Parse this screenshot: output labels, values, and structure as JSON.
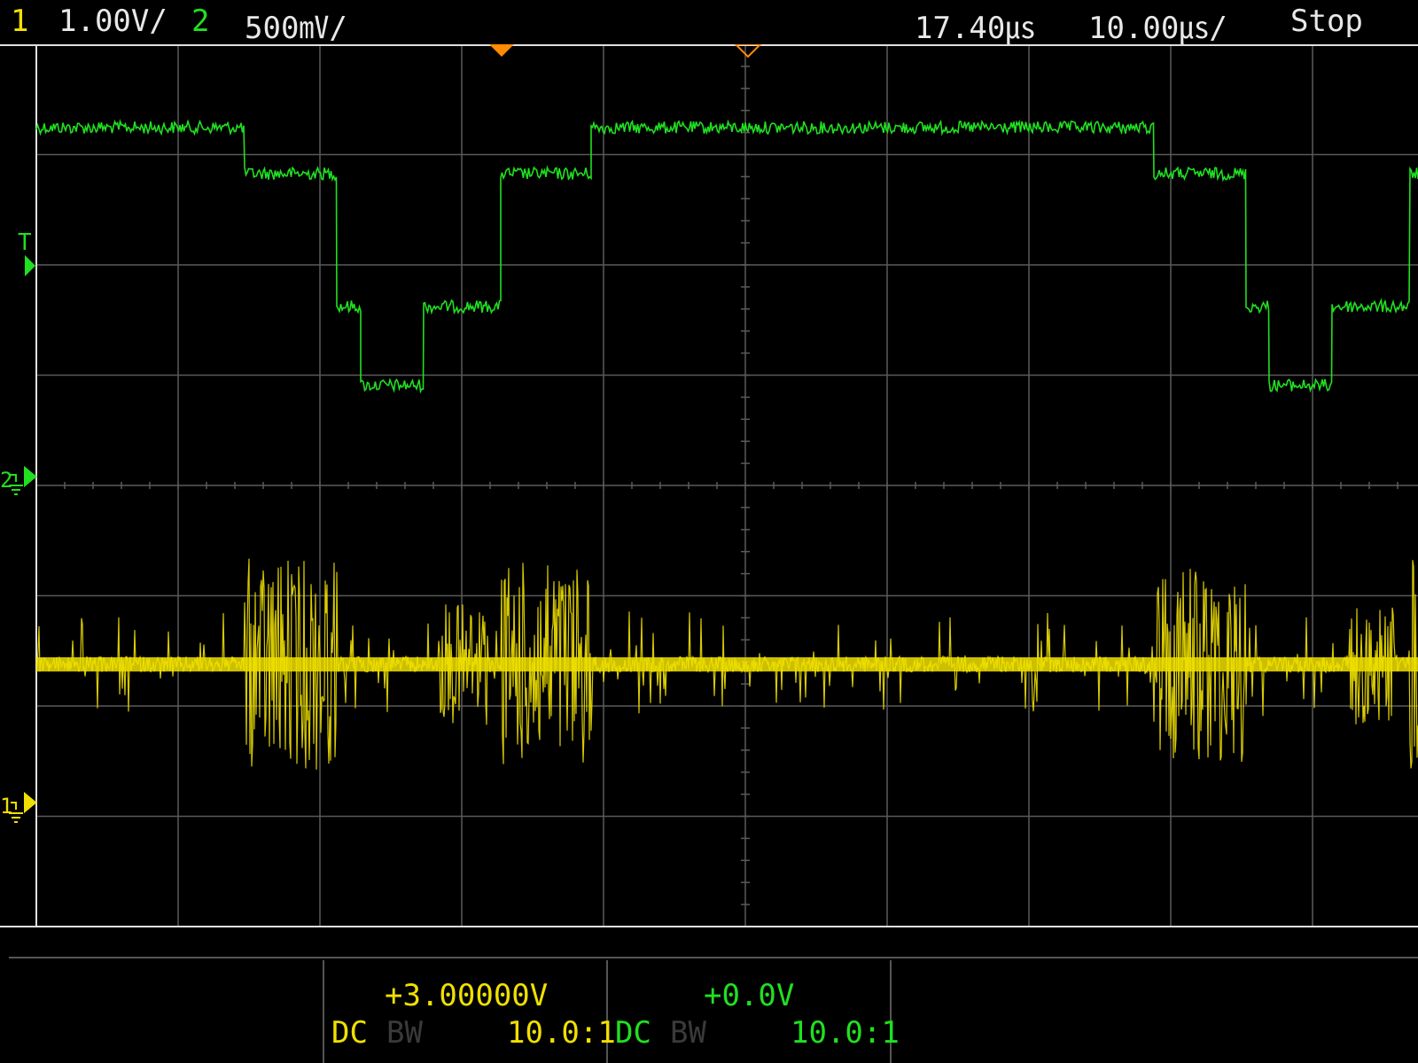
{
  "header": {
    "ch1_num": "1",
    "ch1_scale": "1.00V/",
    "ch2_num": "2",
    "ch2_scale": "500㎷/",
    "time_delay": "17.40㎲",
    "time_scale": "10.00㎲/",
    "run_state": "Stop"
  },
  "markers": {
    "trigger_label": "T",
    "ch2_ground_label": "2",
    "ch1_ground_label": "1"
  },
  "footer": {
    "ch1_offset": "+3.00000V",
    "ch1_coupling": "DC",
    "ch1_bw": "BW",
    "ch1_probe": "10.0:1",
    "ch2_offset": "+0.0V",
    "ch2_coupling": "DC",
    "ch2_bw": "BW",
    "ch2_probe": "10.0:1"
  },
  "colors": {
    "ch1": "#f0e000",
    "ch2": "#20e020",
    "trigger_marker": "#ff8c00",
    "grid": "#5a5a5a",
    "frame": "#e0e0e0"
  },
  "trace_ch2": {
    "description_levels": [
      "high",
      "mid",
      "low",
      "lowest"
    ]
  }
}
